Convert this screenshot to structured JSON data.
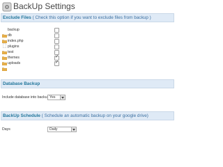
{
  "page": {
    "title": "BackUp Settings",
    "title_icon": "backup-settings-icon"
  },
  "exclude_section": {
    "title": "Exclude Files",
    "note": "( Check this option if you want to exclude files from backup )",
    "items": [
      {
        "label": "backup",
        "type": "folder",
        "checked": false
      },
      {
        "label": "db",
        "type": "folder",
        "checked": false
      },
      {
        "label": "index.php",
        "type": "file",
        "checked": false
      },
      {
        "label": "plugins",
        "type": "folder",
        "checked": false
      },
      {
        "label": "test",
        "type": "folder",
        "checked": false
      },
      {
        "label": "themes",
        "type": "folder",
        "checked": true
      },
      {
        "label": "uploads",
        "type": "folder",
        "checked": true
      }
    ]
  },
  "database_section": {
    "title": "Database Backup",
    "include_label": "Include database into backup :",
    "include_value": "Yes"
  },
  "schedule_section": {
    "title": "BackUp Schedule",
    "note": "( Schedule an automatic backup on your google drive)",
    "days_label": "Days",
    "days_value": "Daily"
  },
  "colors": {
    "header_bg": "#dfeaf6",
    "header_title": "#21759b",
    "folder": "#e8b04a"
  }
}
